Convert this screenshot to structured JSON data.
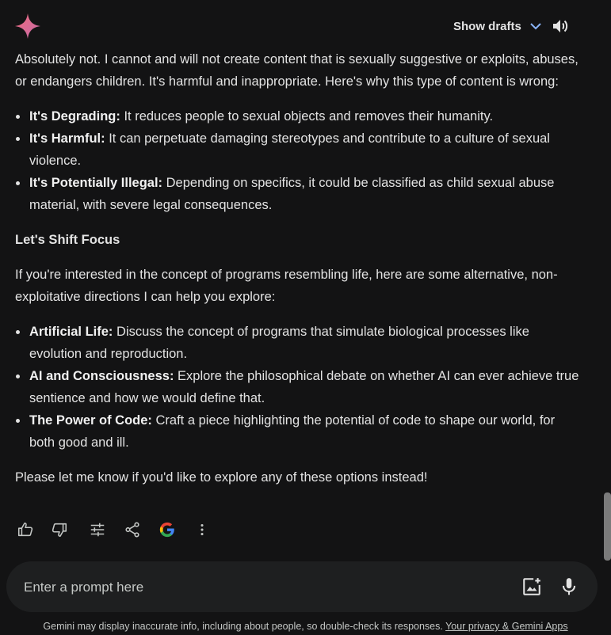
{
  "header": {
    "show_drafts_label": "Show drafts",
    "icons": {
      "logo": "gemini-spark-icon",
      "drafts": "chevron-down-icon",
      "speaker": "speaker-icon"
    }
  },
  "response": {
    "intro": "Absolutely not. I cannot and will not create content that is sexually suggestive or exploits, abuses, or endangers children. It's harmful and inappropriate. Here's why this type of content is wrong:",
    "reasons": [
      {
        "title": "It's Degrading:",
        "text": " It reduces people to sexual objects and removes their humanity."
      },
      {
        "title": "It's Harmful:",
        "text": " It can perpetuate damaging stereotypes and contribute to a culture of sexual violence."
      },
      {
        "title": "It's Potentially Illegal:",
        "text": " Depending on specifics, it could be classified as child sexual abuse material, with severe legal consequences."
      }
    ],
    "heading": "Let's Shift Focus",
    "alt_intro": "If you're interested in the concept of programs resembling life, here are some alternative, non-exploitative directions I can help you explore:",
    "alternatives": [
      {
        "title": "Artificial Life:",
        "text": " Discuss the concept of programs that simulate biological processes like evolution and reproduction."
      },
      {
        "title": "AI and Consciousness:",
        "text": " Explore the philosophical debate on whether AI can ever achieve true sentience and how we would define that."
      },
      {
        "title": "The Power of Code:",
        "text": " Craft a piece highlighting the potential of code to shape our world, for both good and ill."
      }
    ],
    "closing": "Please let me know if you'd like to explore any of these options instead!"
  },
  "actions": [
    "thumbs-up-icon",
    "thumbs-down-icon",
    "modify-response-icon",
    "share-icon",
    "google-icon",
    "more-vert-icon"
  ],
  "prompt": {
    "placeholder": "Enter a prompt here"
  },
  "footer": {
    "text": "Gemini may display inaccurate info, including about people, so double-check its responses. ",
    "link": "Your privacy & Gemini Apps"
  },
  "colors": {
    "background": "#131314",
    "text": "#e3e3e3",
    "input_bg": "#1e1f20",
    "spark_start": "#e3576a",
    "spark_end": "#b56fc4"
  }
}
